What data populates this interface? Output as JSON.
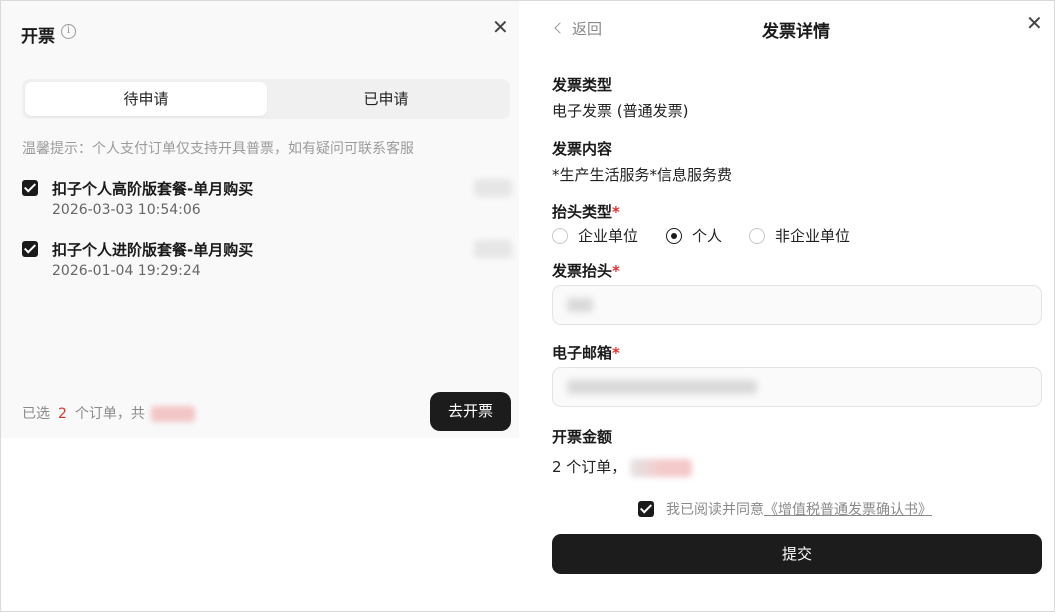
{
  "left": {
    "title": "开票",
    "tabs": [
      "待申请",
      "已申请"
    ],
    "hint": "温馨提示：个人支付订单仅支持开具普票，如有疑问可联系客服",
    "orders": [
      {
        "name": "扣子个人高阶版套餐-单月购买",
        "time": "2026-03-03 10:54:06",
        "checked": true
      },
      {
        "name": "扣子个人进阶版套餐-单月购买",
        "time": "2026-01-04 19:29:24",
        "checked": true
      }
    ],
    "footer": {
      "prefix": "已选",
      "count": "2",
      "suffix": "个订单，共"
    },
    "issue_button": "去开票"
  },
  "right": {
    "back": "返回",
    "title": "发票详情",
    "invoice_type_label": "发票类型",
    "invoice_type_value": "电子发票 (普通发票)",
    "content_label": "发票内容",
    "content_value": "*生产生活服务*信息服务费",
    "header_type_label": "抬头类型",
    "header_type_options": [
      "企业单位",
      "个人",
      "非企业单位"
    ],
    "header_type_selected": "个人",
    "header_label": "发票抬头",
    "email_label": "电子邮箱",
    "amount_label": "开票金额",
    "amount_prefix": "2 个订单，",
    "agree_prefix": "我已阅读并同意",
    "agree_link": "《增值税普通发票确认书》",
    "submit": "提交",
    "required_mark": "*"
  },
  "icons": [
    "info-icon",
    "close-icon",
    "chevron-left-icon",
    "checkbox-checked-icon",
    "radio-icon"
  ],
  "colors": {
    "accent": "#1c1c1c",
    "required": "#e0312f",
    "muted": "#9b9b9b"
  }
}
